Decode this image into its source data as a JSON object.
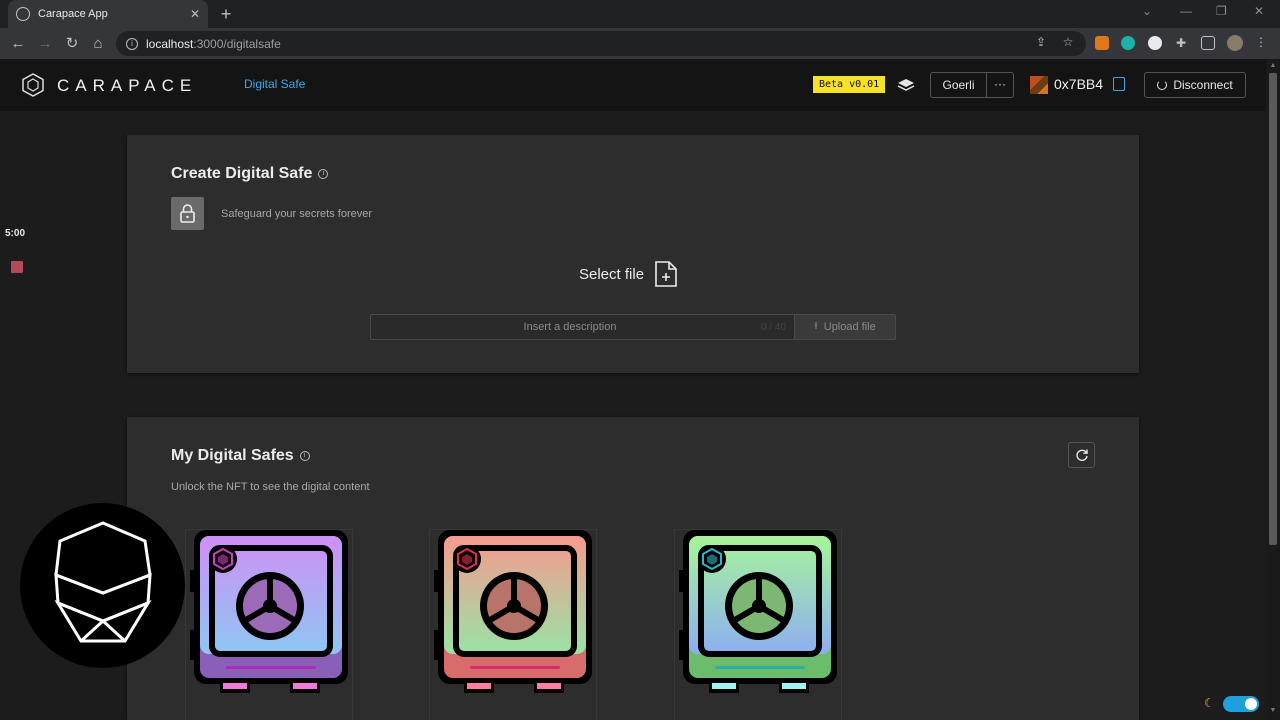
{
  "browser": {
    "tab_title": "Carapace App",
    "tab_close": "✕",
    "new_tab": "+",
    "url_host": "localhost",
    "url_path": ":3000/digitalsafe",
    "nav": {
      "back": "back-icon",
      "forward": "forward-icon",
      "reload": "reload-icon",
      "home": "home-icon"
    }
  },
  "header": {
    "brand": "CARAPACE",
    "nav_link": "Digital Safe",
    "beta_badge": "Beta v0.01",
    "network": "Goerli",
    "more": "···",
    "address": "0x7BB4",
    "disconnect": "Disconnect"
  },
  "create": {
    "title": "Create Digital Safe",
    "subtitle": "Safeguard your secrets forever",
    "select_file": "Select file",
    "desc_placeholder": "Insert a description",
    "desc_counter": "0 / 40",
    "upload": "Upload file"
  },
  "safes": {
    "title": "My Digital Safes",
    "subtitle": "Unlock the NFT to see the digital content",
    "items": [
      {
        "theme": "purple",
        "top": "#cf8ff5",
        "bottom": "#8ec6f2",
        "base": "#8a5fb8",
        "badge": "#cc3ec4",
        "feet": "#f07bd8",
        "caption": "#b41fb4"
      },
      {
        "theme": "salmon",
        "top": "#f59a8e",
        "bottom": "#9ae3a6",
        "base": "#d86c6c",
        "badge": "#e3304a",
        "feet": "#ff7f9f",
        "caption": "#d01f6a"
      },
      {
        "theme": "green",
        "top": "#a6f59a",
        "bottom": "#8eaef2",
        "base": "#6bbd6b",
        "badge": "#2ab7c9",
        "feet": "#9ff2f2",
        "caption": "#20a8b8"
      }
    ]
  },
  "overlay": {
    "timer": "5:00",
    "theme_icon": "☾"
  },
  "colors": {
    "accent": "#3fa8e0",
    "beta": "#f5e12a",
    "card": "#2d2d2d",
    "background": "#1c1c1c"
  }
}
